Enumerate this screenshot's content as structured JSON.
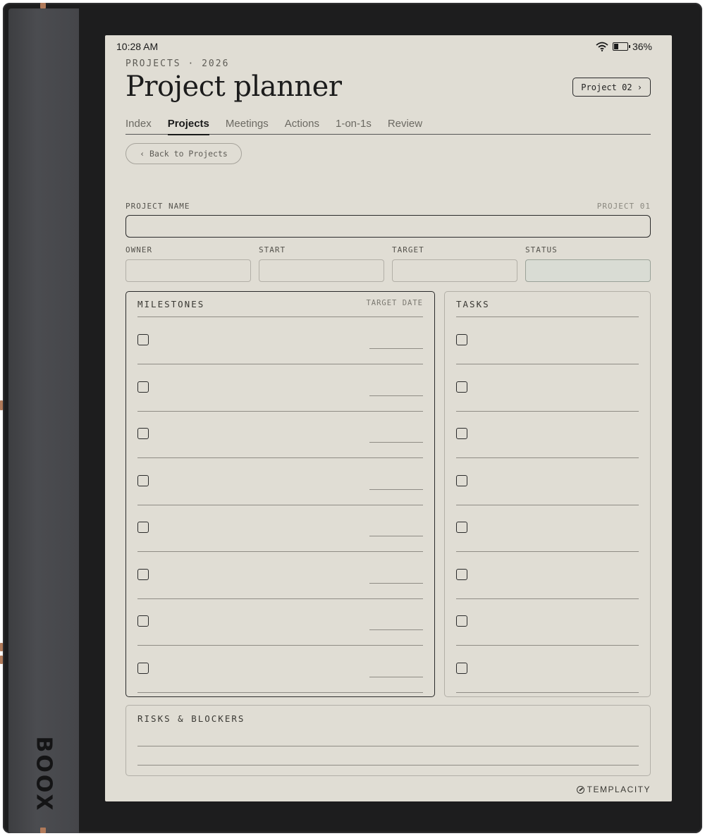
{
  "status_bar": {
    "time": "10:28 AM",
    "battery_text": "36%",
    "battery_level": 0.36
  },
  "header": {
    "eyebrow": "PROJECTS · 2026",
    "title": "Project planner",
    "next_button": "Project 02 ›"
  },
  "tabs": [
    {
      "label": "Index",
      "active": false
    },
    {
      "label": "Projects",
      "active": true
    },
    {
      "label": "Meetings",
      "active": false
    },
    {
      "label": "Actions",
      "active": false
    },
    {
      "label": "1-on-1s",
      "active": false
    },
    {
      "label": "Review",
      "active": false
    }
  ],
  "back_button": "‹ Back to Projects",
  "form": {
    "project_name_label": "PROJECT NAME",
    "project_number": "PROJECT 01",
    "owner_label": "OWNER",
    "start_label": "START",
    "target_label": "TARGET",
    "status_label": "STATUS"
  },
  "milestones": {
    "title": "MILESTONES",
    "column": "TARGET DATE",
    "rows": 8
  },
  "tasks": {
    "title": "TASKS",
    "rows": 8
  },
  "risks": {
    "title": "RISKS & BLOCKERS"
  },
  "device": {
    "brand": "BOOX",
    "accent_color": "#b07a5a"
  },
  "footer": {
    "logo_text": "TEMPLACITY"
  }
}
